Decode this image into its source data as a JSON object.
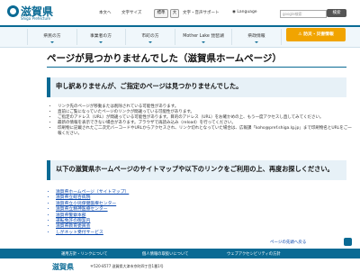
{
  "header": {
    "logo_text": "滋賀県",
    "logo_sub": "Shiga Prefecture",
    "text_size_label": "本文へ",
    "font_size_label": "文字サイズ",
    "font_std": "標準",
    "font_large": "大",
    "color_label": "文字・音声サポート",
    "language_label": "Language",
    "search_placeholder": "google検索",
    "search_button": "検索"
  },
  "nav": {
    "items": [
      "県民の方",
      "事業者の方",
      "市町の方",
      "Mother Lake 琵琶湖",
      "県政情報"
    ],
    "emergency": "防災・災害情報"
  },
  "main": {
    "title": "ページが見つかりませんでした（滋賀県ホームページ）",
    "notice_heading": "申し訳ありませんが、ご指定のページは見つかりませんでした。",
    "notes": [
      "リンク先のページが移動または削除されている可能性があります。",
      "直前にご覧になっていたページのリンクが間違っている可能性があります。",
      "ご指定のアドレス（URL）が間違っている可能性があります。目的のアドレス（URL）をお確かめの上、もう一度アクセスし直してみてください。",
      "最新の情報を表示できない場合があります。ブラウザで再読み込み（reload）を行ってください。",
      "印刷物に記載されたご二次元バーコードやURLからアクセスされ、リンク切れとなっていた場合は、広報課「koho@pref.shiga.lg.jp」まで印刷物名とURLをご一報ください。"
    ],
    "links_heading": "以下の滋賀県ホームページのサイトマップや以下のリンクをご利用の上、再度お探しください。",
    "links": [
      "滋賀県ホームページ（サイトマップ）",
      "滋賀県立総合病院",
      "滋賀県立小児保健医療センター",
      "滋賀県立精神医療センター",
      "滋賀県警察本部",
      "運転免許の御案内",
      "滋賀県教育委員会",
      "しがネット受付サービス"
    ],
    "pagetop": "ページの先頭へ戻る"
  },
  "footer": {
    "links": [
      "運用方針・リンクについて",
      "個人情報の取扱いについて",
      "ウェブアクセシビリティの方針"
    ],
    "logo": "滋賀県",
    "address": "〒520-8577 滋賀県大津市京町四丁目1番1号"
  },
  "colors": {
    "brand": "#0a6a94",
    "emergency": "#f1a400",
    "link": "#0645ad"
  }
}
